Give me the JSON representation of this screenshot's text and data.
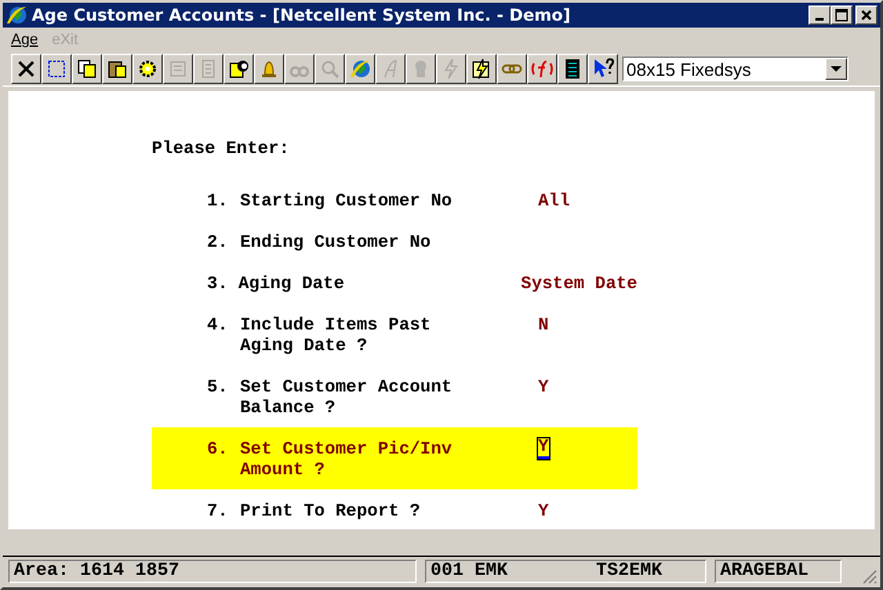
{
  "window": {
    "title": "Age Customer Accounts - [Netcellent System Inc. - Demo]"
  },
  "menu": [
    {
      "label": "Age",
      "disabled": false
    },
    {
      "label": "eXit",
      "disabled": true
    }
  ],
  "toolbar": [
    {
      "disabled": false
    },
    {
      "disabled": false
    },
    {
      "disabled": false
    },
    {
      "disabled": false
    },
    {
      "disabled": false
    },
    {
      "disabled": true
    },
    {
      "disabled": true
    },
    {
      "disabled": false
    },
    {
      "disabled": false
    },
    {
      "disabled": true
    },
    {
      "disabled": true
    },
    {
      "disabled": false
    },
    {
      "disabled": true
    },
    {
      "disabled": true
    },
    {
      "disabled": true
    },
    {
      "disabled": false
    },
    {
      "disabled": false
    },
    {
      "disabled": false
    },
    {
      "disabled": false
    },
    {
      "disabled": false
    }
  ],
  "font_select": {
    "value": "08x15 Fixedsys"
  },
  "prompt": "Please Enter:",
  "fields": [
    {
      "number": "1.",
      "label": [
        "Starting Customer No"
      ],
      "value": "All",
      "selected": false
    },
    {
      "number": "2.",
      "label": [
        "Ending Customer No"
      ],
      "selected": false
    },
    {
      "number": "3.",
      "label": [
        "Aging Date"
      ],
      "value": "System Date",
      "selected": false
    },
    {
      "number": "4.",
      "label": [
        "Include Items Past",
        "Aging Date ?"
      ],
      "value": "N",
      "selected": false
    },
    {
      "number": "5.",
      "label": [
        "Set Customer Account",
        "Balance ?"
      ],
      "value": "Y",
      "selected": false
    },
    {
      "number": "6.",
      "label": [
        "Set Customer Pic/Inv",
        "Amount ?"
      ],
      "value": "Y",
      "selected": true
    },
    {
      "number": "7.",
      "label": [
        "Print To Report ?"
      ],
      "value": "Y",
      "selected": false
    }
  ],
  "status_bar": [
    "Area: 1614 1857",
    "001 EMK",
    "TS2EMK",
    "ARAGEBAL"
  ]
}
